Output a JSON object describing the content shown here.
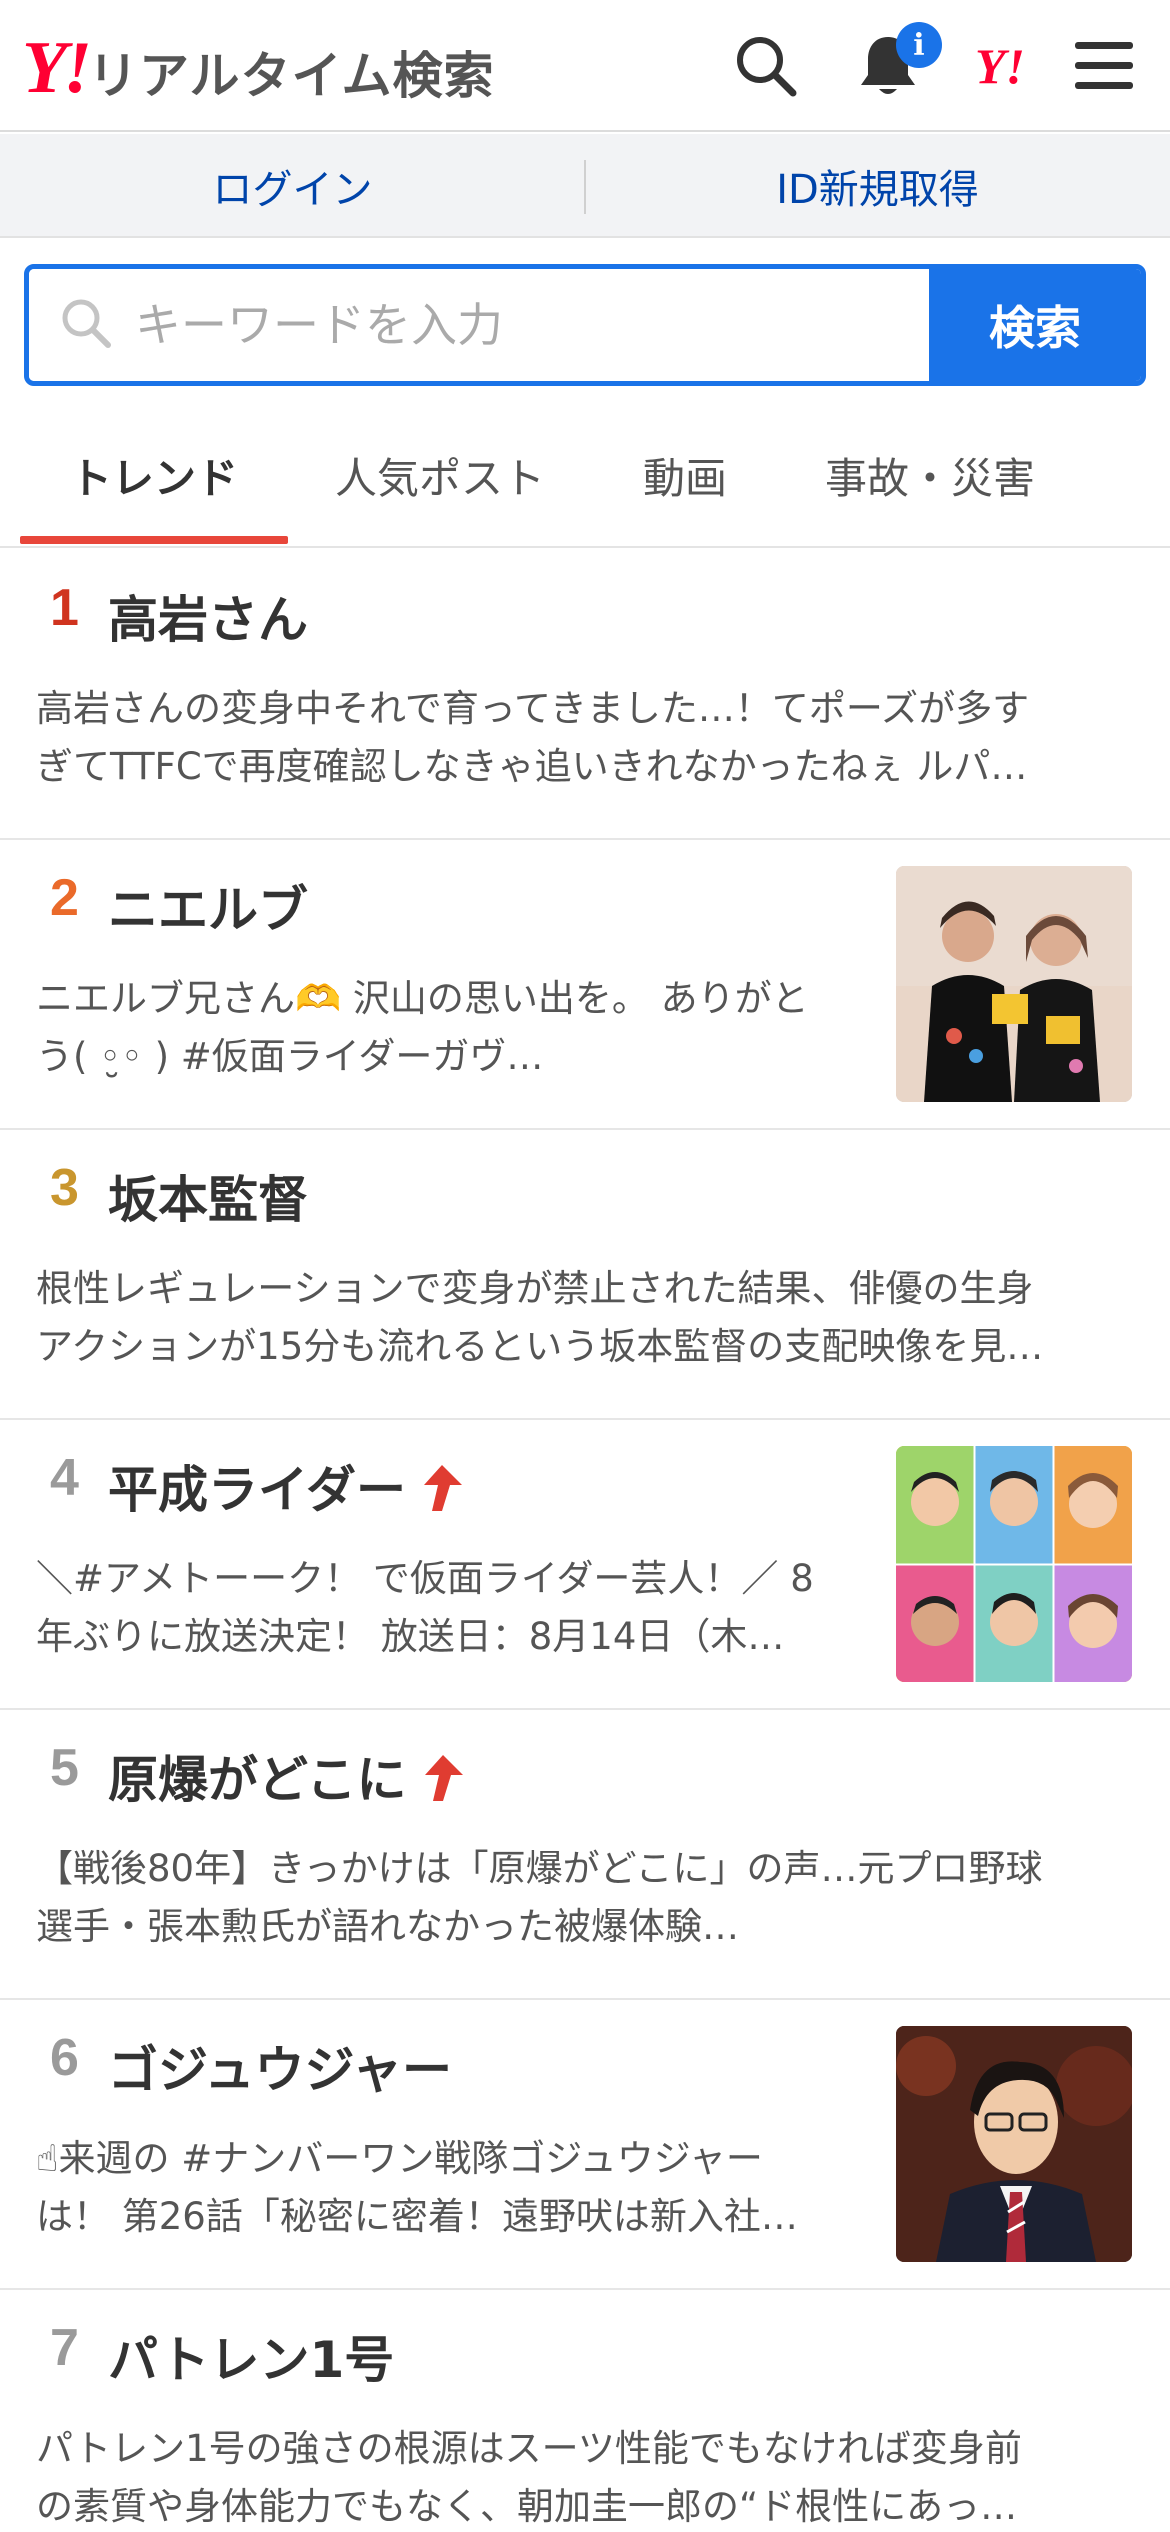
{
  "header": {
    "logo_mark": "Y!",
    "logo_text": "リアルタイム検索",
    "notification_badge": "i",
    "yj_mark": "Y!",
    "icons": [
      "search-icon",
      "bell-icon",
      "yahoo-japan-icon",
      "hamburger-menu-icon"
    ]
  },
  "login_bar": {
    "login": "ログイン",
    "register": "ID新規取得"
  },
  "search": {
    "placeholder": "キーワードを入力",
    "value": "",
    "button": "検索"
  },
  "tabs": [
    {
      "label": "トレンド",
      "active": true
    },
    {
      "label": "人気ポスト",
      "active": false
    },
    {
      "label": "動画",
      "active": false
    },
    {
      "label": "事故・災害",
      "active": false
    }
  ],
  "colors": {
    "accent_blue": "#1a73e8",
    "tab_underline": "#e8463a",
    "rank1": "#d0341f",
    "rank2": "#ea6a2a",
    "rank3": "#c9962e",
    "rank_other": "#9a9a9a",
    "rising_arrow": "#e03c31"
  },
  "trends": [
    {
      "rank": "1",
      "title": "高岩さん",
      "rising": false,
      "thumbnail": false,
      "desc": [
        "高岩さんの変身中それで育ってきました…！てポーズが多す",
        "ぎてTTFCで再度確認しなきゃ追いきれなかったねぇ ルパ…"
      ]
    },
    {
      "rank": "2",
      "title": "ニエルブ",
      "rising": false,
      "thumbnail": true,
      "desc": [
        "ニエルブ兄さん🫶 沢山の思い出を。 ありがと",
        "う( ◦̮◦ ) #仮面ライダーガヴ…"
      ]
    },
    {
      "rank": "3",
      "title": "坂本監督",
      "rising": false,
      "thumbnail": false,
      "desc": [
        "根性レギュレーションで変身が禁止された結果、俳優の生身",
        "アクションが15分も流れるという坂本監督の支配映像を見…"
      ]
    },
    {
      "rank": "4",
      "title": "平成ライダー",
      "rising": true,
      "thumbnail": true,
      "desc": [
        "＼#アメトーーク！ で仮面ライダー芸人！／ 8",
        "年ぶりに放送決定！ 放送日：8月14日（木…"
      ]
    },
    {
      "rank": "5",
      "title": "原爆がどこに",
      "rising": true,
      "thumbnail": false,
      "desc": [
        "【戦後80年】きっかけは「原爆がどこに」の声…元プロ野球",
        "選手・張本勲氏が語れなかった被爆体験…"
      ]
    },
    {
      "rank": "6",
      "title": "ゴジュウジャー",
      "rising": false,
      "thumbnail": true,
      "desc": [
        "☝来週の #ナンバーワン戦隊ゴジュウジャー",
        "は！ 第26話「秘密に密着！遠野吠は新入社…"
      ]
    },
    {
      "rank": "7",
      "title": "パトレン1号",
      "rising": false,
      "thumbnail": false,
      "desc": [
        "パトレン1号の強さの根源はスーツ性能でもなければ変身前",
        "の素質や身体能力でもなく、朝加圭一郎の“ド根性にあっ…"
      ]
    }
  ]
}
